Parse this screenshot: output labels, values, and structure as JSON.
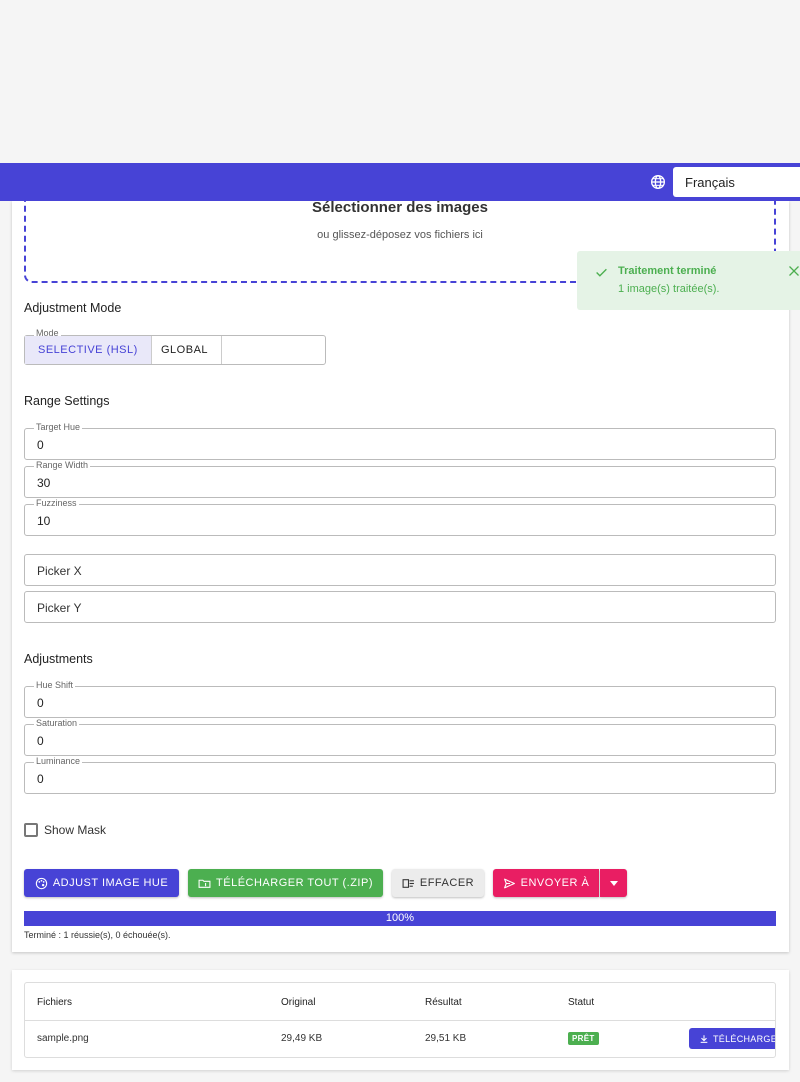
{
  "header": {
    "language_selected": "Français",
    "icon": "globe-icon"
  },
  "dropzone": {
    "title": "Sélectionner des images",
    "subtitle": "ou glissez-déposez vos fichiers ici"
  },
  "adjustment_mode": {
    "section_title": "Adjustment Mode",
    "legend": "Mode",
    "options": [
      "SELECTIVE (HSL)",
      "GLOBAL"
    ],
    "selected": "SELECTIVE (HSL)"
  },
  "range_settings": {
    "section_title": "Range Settings",
    "target_hue": {
      "label": "Target Hue",
      "value": "0"
    },
    "range_width": {
      "label": "Range Width",
      "value": "30"
    },
    "fuzziness": {
      "label": "Fuzziness",
      "value": "10"
    },
    "picker_x": {
      "placeholder": "Picker X"
    },
    "picker_y": {
      "placeholder": "Picker Y"
    }
  },
  "adjustments": {
    "section_title": "Adjustments",
    "hue_shift": {
      "label": "Hue Shift",
      "value": "0"
    },
    "saturation": {
      "label": "Saturation",
      "value": "0"
    },
    "luminance": {
      "label": "Luminance",
      "value": "0"
    }
  },
  "show_mask": {
    "label": "Show Mask",
    "checked": false
  },
  "actions": {
    "adjust_label": "ADJUST IMAGE HUE",
    "zip_label": "TÉLÉCHARGER TOUT (.ZIP)",
    "clear_label": "EFFACER",
    "send_label": "ENVOYER À"
  },
  "progress": {
    "percent": 100,
    "label": "100%",
    "status": "Terminé : 1 réussie(s), 0 échouée(s)."
  },
  "files_table": {
    "headers": [
      "Fichiers",
      "Original",
      "Résultat",
      "Statut"
    ],
    "rows": [
      {
        "file": "sample.png",
        "original": "29,49 KB",
        "result": "29,51 KB",
        "status": "PRÊT",
        "action": "TÉLÉCHARGER"
      }
    ]
  },
  "toast": {
    "title": "Traitement terminé",
    "message": "1 image(s) traitée(s)."
  },
  "colors": {
    "primary": "#4743d6",
    "success": "#4caf50",
    "accent": "#e91e63",
    "toast_bg": "#e5f3e6"
  }
}
